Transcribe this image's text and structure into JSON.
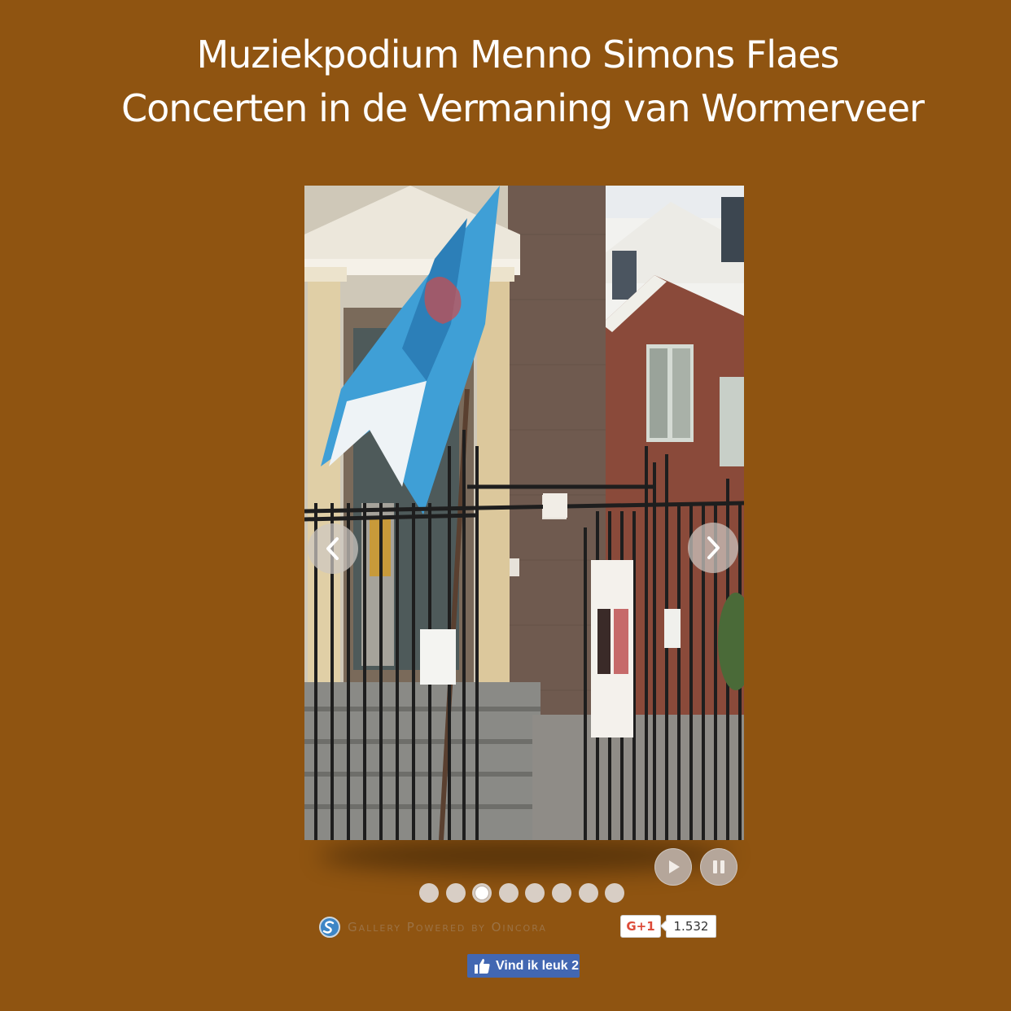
{
  "header": {
    "title_line1": "Muziekpodium Menno Simons Flaes",
    "title_line2": "Concerten in de Vermaning van Wormerveer"
  },
  "gallery": {
    "slide_count": 8,
    "active_index": 2,
    "credit": "Gallery Powered by Oincora"
  },
  "social": {
    "gplus_label": "G+1",
    "gplus_count": "1.532",
    "fb_label": "Vind ik leuk 2"
  },
  "colors": {
    "background": "#8f5411",
    "title": "#ffffff",
    "fb_blue": "#4267b2",
    "gplus_red": "#dd4b39"
  },
  "icons": {
    "prev": "chevron-left-icon",
    "next": "chevron-right-icon",
    "play": "play-icon",
    "pause": "pause-icon",
    "logo": "sincora-logo-icon",
    "like": "thumbs-up-icon"
  }
}
